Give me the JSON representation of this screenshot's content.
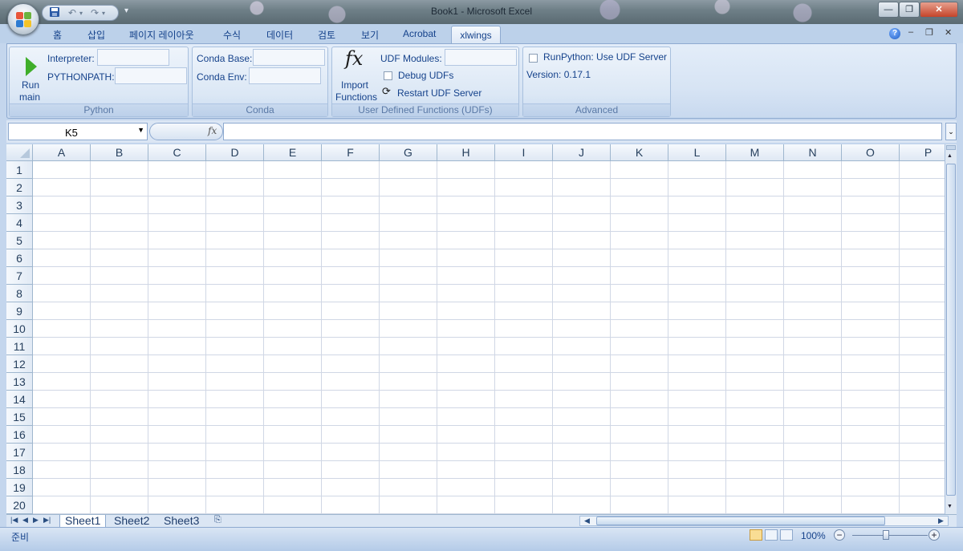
{
  "window": {
    "title": "Book1 - Microsoft Excel",
    "controls": {
      "minimize": "—",
      "restore": "❐",
      "close": "✕"
    }
  },
  "quick_access": {
    "save_icon": "save-icon",
    "undo_icon": "undo-icon",
    "redo_icon": "redo-icon",
    "customize": "▾"
  },
  "ribbon_tabs": [
    {
      "label": "홈"
    },
    {
      "label": "삽입"
    },
    {
      "label": "페이지 레이아웃"
    },
    {
      "label": "수식"
    },
    {
      "label": "데이터"
    },
    {
      "label": "검토"
    },
    {
      "label": "보기"
    },
    {
      "label": "Acrobat"
    },
    {
      "label": "xlwings",
      "active": true
    }
  ],
  "ribbon_right": {
    "help": "?",
    "min": "–",
    "restore": "❐",
    "close": "✕"
  },
  "groups": {
    "python": {
      "label": "Python",
      "run_label_1": "Run",
      "run_label_2": "main",
      "interpreter_label": "Interpreter:",
      "interpreter_value": "",
      "pythonpath_label": "PYTHONPATH:",
      "pythonpath_value": ""
    },
    "conda": {
      "label": "Conda",
      "base_label": "Conda Base:",
      "base_value": "",
      "env_label": "Conda Env:",
      "env_value": ""
    },
    "udfs": {
      "label": "User Defined Functions (UDFs)",
      "fx_glyph": "fx",
      "import_label_1": "Import",
      "import_label_2": "Functions",
      "modules_label": "UDF Modules:",
      "modules_value": "",
      "debug_label": "Debug UDFs",
      "debug_checked": false,
      "restart_label": "Restart UDF Server"
    },
    "advanced": {
      "label": "Advanced",
      "runpython_label": "RunPython: Use UDF Server",
      "runpython_checked": false,
      "version": "Version: 0.17.1"
    }
  },
  "formula_bar": {
    "name_box": "K5",
    "fx": "fx",
    "formula": ""
  },
  "grid": {
    "columns": [
      "A",
      "B",
      "C",
      "D",
      "E",
      "F",
      "G",
      "H",
      "I",
      "J",
      "K",
      "L",
      "M",
      "N",
      "O",
      "P"
    ],
    "rows": [
      "1",
      "2",
      "3",
      "4",
      "5",
      "6",
      "7",
      "8",
      "9",
      "10",
      "11",
      "12",
      "13",
      "14",
      "15",
      "16",
      "17",
      "18",
      "19",
      "20"
    ]
  },
  "sheet_tabs": [
    {
      "label": "Sheet1",
      "active": true
    },
    {
      "label": "Sheet2"
    },
    {
      "label": "Sheet3"
    }
  ],
  "status": {
    "text": "준비",
    "zoom": "100%"
  },
  "colors": {
    "ribbon_blue": "#15428b",
    "run_green": "#3fae2a",
    "page_bg": "#c4d6ed"
  }
}
